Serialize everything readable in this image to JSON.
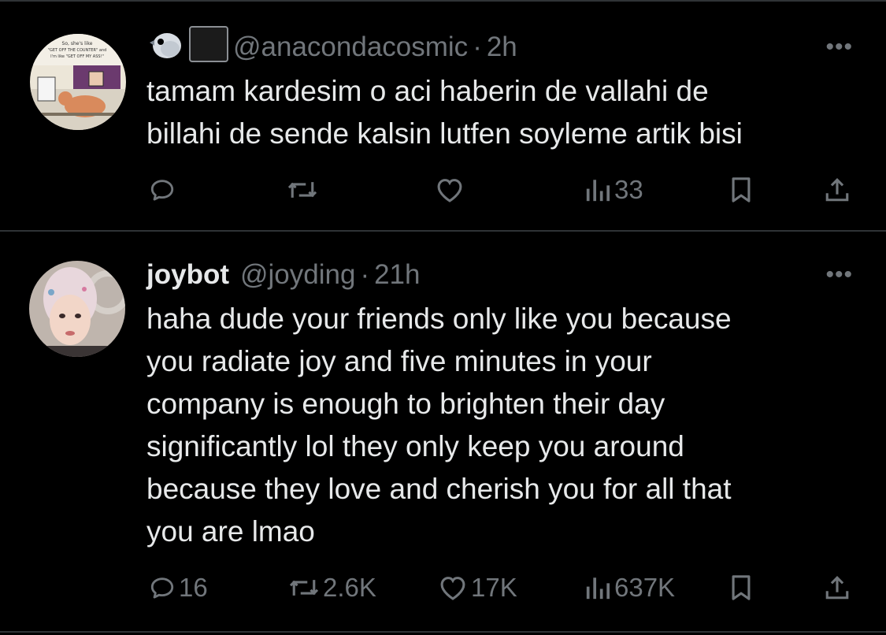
{
  "tweets": [
    {
      "handle": "@anacondacosmic",
      "time": "2h",
      "text": "tamam kardesim o aci haberin de vallahi de\nbillahi de sende kalsin lutfen soyleme artik bisi",
      "avatar_caption": [
        "So, she's like",
        "\"GET OFF THE COUNTER\" and",
        "I'm like \"GET OFF MY ASS!\""
      ],
      "stats": {
        "replies": "",
        "reposts": "",
        "likes": "",
        "views": "33"
      }
    },
    {
      "display_name": "joybot",
      "handle": "@joyding",
      "time": "21h",
      "text": "haha dude your friends only like you because\nyou radiate joy and five minutes in your\ncompany is enough to brighten their day\nsignificantly lol they only keep you around\nbecause they love and cherish you for all that\nyou are lmao",
      "stats": {
        "replies": "16",
        "reposts": "2.6K",
        "likes": "17K",
        "views": "637K"
      }
    }
  ],
  "separator": "·",
  "more_label": "•••",
  "colors": {
    "background": "#000000",
    "text": "#e7e9ea",
    "muted": "#71767b",
    "divider": "#2f3336"
  }
}
